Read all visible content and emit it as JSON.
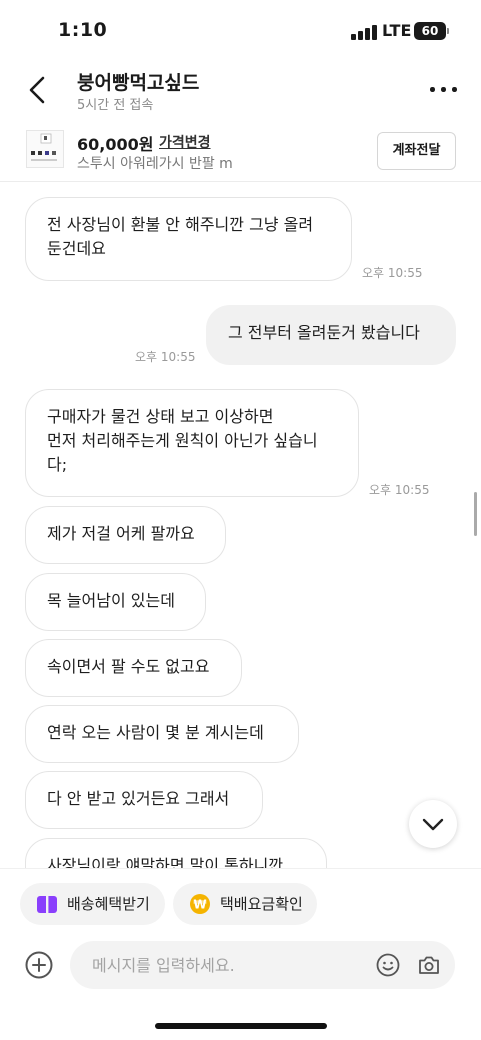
{
  "status_bar": {
    "time": "1:10",
    "network": "LTE",
    "battery": "60"
  },
  "header": {
    "name": "붕어빵먹고싶드",
    "last_seen": "5시간 전 접속"
  },
  "product": {
    "price": "60,000원",
    "price_change_label": "가격변경",
    "title": "스투시 아워레가시 반팔 m",
    "transfer_button": "계좌전달"
  },
  "messages": [
    {
      "side": "received",
      "text": "전 사장님이 환불 안 해주니깐 그냥 올려\n둔건데요",
      "time": "오후 10:55"
    },
    {
      "side": "sent",
      "text": "그 전부터 올려둔거 봤습니다",
      "time": "오후 10:55"
    },
    {
      "side": "received",
      "text": "구매자가 물건 상태 보고 이상하면\n먼저 처리해주는게 원칙이 아닌가 싶습니\n다;",
      "time": "오후 10:55"
    },
    {
      "side": "received",
      "text": "제가 저걸 어케 팔까요"
    },
    {
      "side": "received",
      "text": "목 늘어남이 있는데"
    },
    {
      "side": "received",
      "text": "속이면서 팔 수도 없고요"
    },
    {
      "side": "received",
      "text": "연락 오는 사람이 몇 분 계시는데"
    },
    {
      "side": "received",
      "text": "다 안 받고 있거든요 그래서"
    },
    {
      "side": "received",
      "text": "사장님이랑 얘말하면 말이 통하니깐"
    }
  ],
  "quick_actions": [
    {
      "label": "배송혜택받기",
      "icon": "gift-box-icon",
      "color": "#8a3ffc"
    },
    {
      "label": "택배요금확인",
      "icon": "won-coin-icon",
      "color": "#f5b400"
    }
  ],
  "input": {
    "placeholder": "메시지를 입력하세요."
  }
}
